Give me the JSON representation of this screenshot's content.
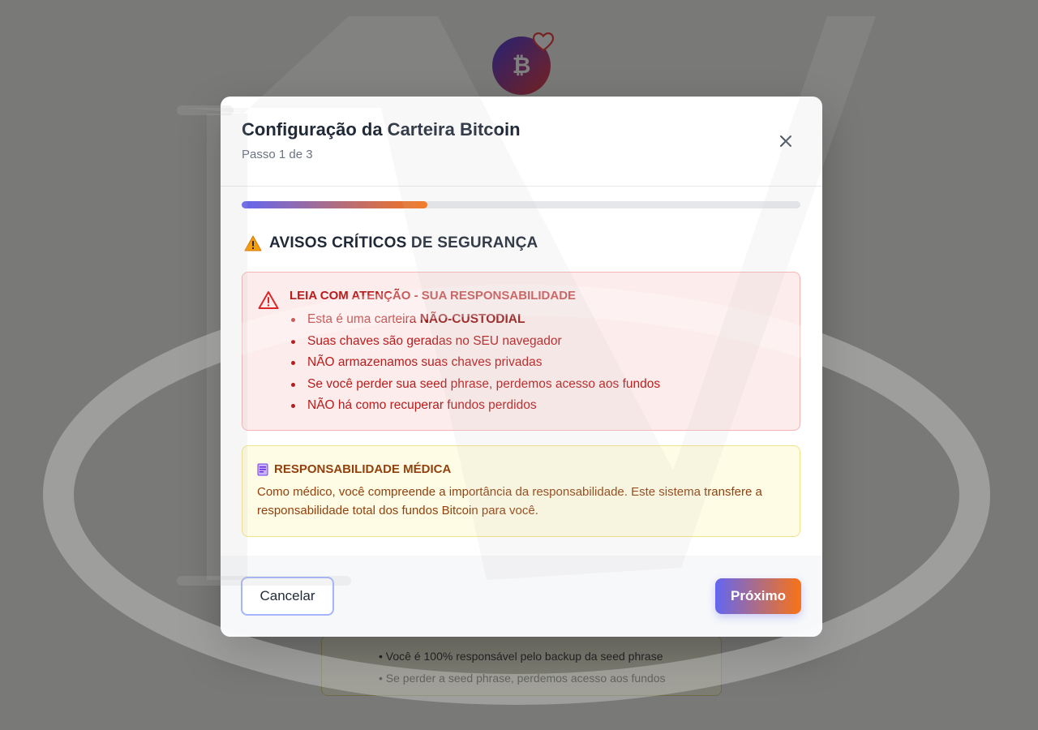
{
  "background": {
    "avatar_symbol": "₿",
    "lines": [
      "• Você é 100% responsável pelo backup da seed phrase",
      "• Se perder a seed phrase, perdemos acesso aos fundos"
    ]
  },
  "modal": {
    "title": "Configuração da Carteira Bitcoin",
    "step": "Passo 1 de 3",
    "progress_fraction": 0.333,
    "section_title": "AVISOS CRÍTICOS DE SEGURANÇA",
    "alert_red": {
      "title": "LEIA COM ATENÇÃO - SUA RESPONSABILIDADE",
      "items": [
        {
          "text": "Esta é uma carteira ",
          "bold": "NÃO-CUSTODIAL"
        },
        {
          "text": "Suas chaves são geradas no SEU navegador"
        },
        {
          "text": "NÃO armazenamos suas chaves privadas"
        },
        {
          "text": "Se você perder sua seed phrase, perdemos acesso aos fundos"
        },
        {
          "text": "NÃO há como recuperar fundos perdidos"
        }
      ]
    },
    "alert_yellow": {
      "title": "RESPONSABILIDADE MÉDICA",
      "text": "Como médico, você compreende a importância da responsabilidade. Este sistema transfere a responsabilidade total dos fundos Bitcoin para você."
    },
    "footer": {
      "cancel_label": "Cancelar",
      "next_label": "Próximo"
    }
  },
  "colors": {
    "accent_start": "#6366f1",
    "accent_end": "#f97316",
    "danger": "#b91c1c",
    "warning": "#92400e"
  }
}
